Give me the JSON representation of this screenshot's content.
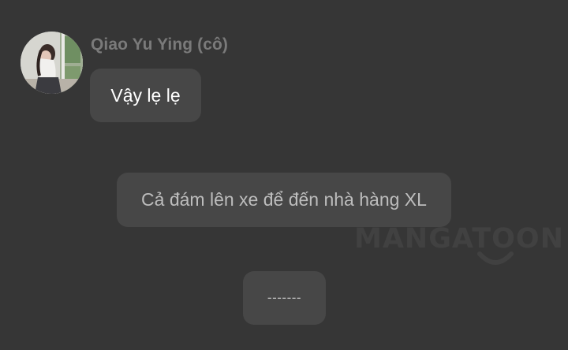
{
  "chat": {
    "sender": {
      "name": "Qiao Yu Ying (cô)",
      "avatar_icon": "profile-photo"
    },
    "message": "Vậy lẹ lẹ",
    "narration": "Cả đám lên xe để đến nhà hàng XL",
    "separator": "-------"
  },
  "watermark": {
    "text": "MANGATOON"
  },
  "colors": {
    "background": "#363636",
    "bubble": "#474747",
    "name": "#7a7a7a",
    "message_text": "#ffffff",
    "narration_text": "#bdbdbd"
  }
}
